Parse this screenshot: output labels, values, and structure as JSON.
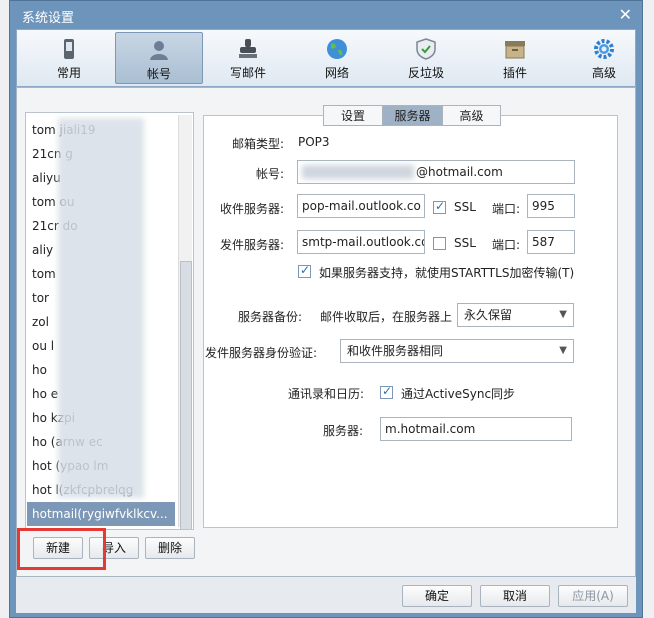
{
  "window": {
    "title": "系统设置"
  },
  "toolbar": {
    "items": [
      {
        "label": "常用",
        "icon": "phone-icon"
      },
      {
        "label": "帐号",
        "icon": "user-icon"
      },
      {
        "label": "写邮件",
        "icon": "stamp-icon"
      },
      {
        "label": "网络",
        "icon": "globe-icon"
      },
      {
        "label": "反垃圾",
        "icon": "shield-icon"
      },
      {
        "label": "插件",
        "icon": "drawer-icon"
      },
      {
        "label": "高级",
        "icon": "gear-icon"
      }
    ]
  },
  "accounts": {
    "items": [
      "tom jiali19",
      "21cn g",
      "aliyu",
      "tom ou",
      "21cr do",
      "aliy",
      "tom",
      "tor",
      "zol",
      "ou l",
      "ho",
      "ho e",
      "ho kzpi",
      "ho (arnw ec",
      "hot (ypao lm",
      "hot l(zkfcpbrelqg",
      "hotmail(rygiwfvklkcv..."
    ],
    "selected_index": 16
  },
  "buttons": {
    "new": "新建",
    "import": "导入",
    "delete": "删除",
    "ok": "确定",
    "cancel": "取消",
    "apply": "应用(A)"
  },
  "tabs": [
    "设置",
    "服务器",
    "高级"
  ],
  "server": {
    "mailbox_type_label": "邮箱类型:",
    "mailbox_type": "POP3",
    "account_label": "帐号:",
    "account_value": "@hotmail.com",
    "incoming_label": "收件服务器:",
    "incoming_value": "pop-mail.outlook.co",
    "outgoing_label": "发件服务器:",
    "outgoing_value": "smtp-mail.outlook.co",
    "ssl_label": "SSL",
    "port_label": "端口:",
    "incoming_port": "995",
    "outgoing_port": "587",
    "incoming_ssl": true,
    "outgoing_ssl": false,
    "starttls_label": "如果服务器支持，就使用STARTTLS加密传输(T)",
    "starttls": true,
    "backup_label": "服务器备份:",
    "backup_text": "邮件收取后，在服务器上",
    "backup_value": "永久保留",
    "auth_label": "发件服务器身份验证:",
    "auth_value": "和收件服务器相同",
    "contacts_label": "通讯录和日历:",
    "activesync_label": "通过ActiveSync同步",
    "activesync": true,
    "server_label": "服务器:",
    "server_value": "m.hotmail.com"
  }
}
